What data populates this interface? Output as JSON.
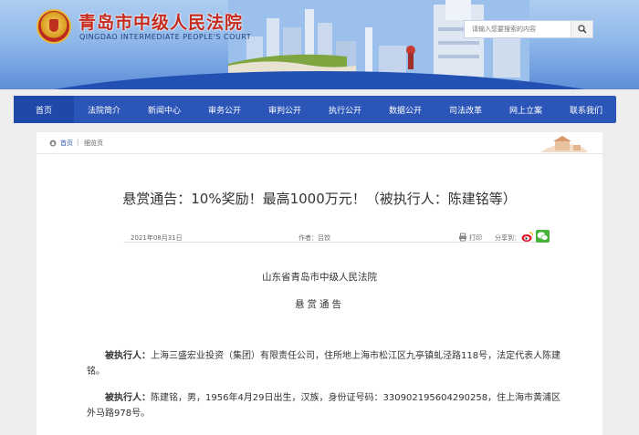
{
  "header": {
    "site_title": "青岛市中级人民法院",
    "site_subtitle": "QINGDAO INTERMEDIATE PEOPLE'S COURT",
    "search_placeholder": "请输入您要搜索的内容",
    "banner_color": "#2350b3"
  },
  "nav": {
    "items": [
      "首页",
      "法院简介",
      "新闻中心",
      "审务公开",
      "审判公开",
      "执行公开",
      "数据公开",
      "司法改革",
      "网上立案",
      "联系我们"
    ],
    "color": "#2b55b8"
  },
  "breadcrumb": {
    "home": "首页",
    "separator": "|",
    "current": "细览页"
  },
  "article": {
    "title": "悬赏通告：10%奖励！最高1000万元！（被执行人：陈建铭等）",
    "date": "2021年08月31日",
    "author": "作者：吕饺",
    "print_label": "打印",
    "share_label": "分享到：",
    "court_name": "山东省青岛市中级人民法院",
    "notice_heading": "悬赏通告",
    "paragraphs": [
      {
        "label": "被执行人：",
        "text": "上海三盛宏业投资（集团）有限责任公司，住所地上海市松江区九亭镇虬泾路118号，法定代表人陈建铭。"
      },
      {
        "label": "被执行人：",
        "text": "陈建铭，男，1956年4月29日出生，汉族，身份证号码：330902195604290258，住上海市黄浦区外马路978号。"
      }
    ]
  }
}
